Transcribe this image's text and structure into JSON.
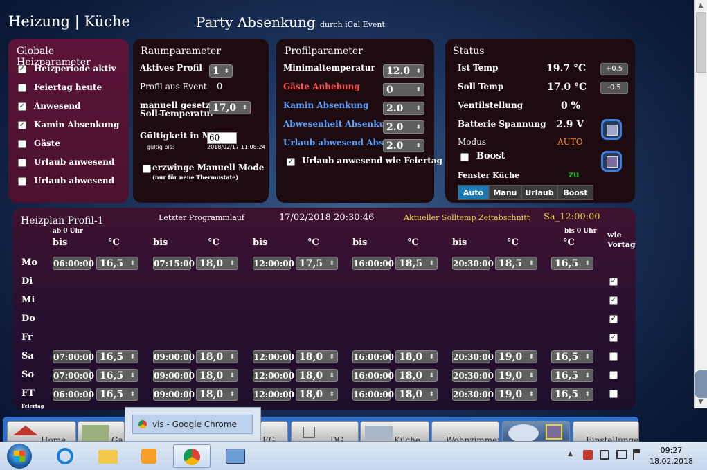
{
  "header": {
    "title": "Heizung | Küche",
    "party": "Party Absenkung",
    "party_sub": "durch iCal Event"
  },
  "global": {
    "title": "Globale Heizparameter",
    "items": [
      {
        "label": "Heizperiode aktiv",
        "checked": "✓"
      },
      {
        "label": "Feiertag heute",
        "checked": ""
      },
      {
        "label": "Anwesend",
        "checked": "✓"
      },
      {
        "label": "Kamin Absenkung",
        "checked": "✓"
      },
      {
        "label": "Gäste",
        "checked": ""
      },
      {
        "label": "Urlaub anwesend",
        "checked": ""
      },
      {
        "label": "Urlaub abwesend",
        "checked": ""
      }
    ]
  },
  "room": {
    "title": "Raumparameter",
    "active_profile_label": "Aktives Profil",
    "active_profile_value": "1",
    "profile_event_label": "Profil aus Event",
    "profile_event_value": "0",
    "manual_label_1": "manuell gesetzte",
    "manual_label_2": "Soll-Temperatur",
    "manual_value": "17,0",
    "valid_label": "Gültigkeit in Min",
    "valid_value": "60",
    "valid_until_label": "gültig bis:",
    "valid_until_value": "2018/02/17 11:08:24",
    "force_label": "erzwinge Manuell Mode",
    "force_sub": "(nur für neue Thermostate)"
  },
  "profile": {
    "title": "Profilparameter",
    "rows": [
      {
        "label": "Minimaltemperatur",
        "value": "12.0"
      },
      {
        "label": "Gäste Anhebung",
        "value": "0"
      },
      {
        "label": "Kamin Absenkung",
        "value": "2.0"
      },
      {
        "label": "Abwesenheit Absenkung",
        "value": "2.0"
      },
      {
        "label": "Urlaub abwesend Abs.",
        "value": "2.0"
      }
    ],
    "holiday_label": "Urlaub anwesend wie Feiertag",
    "holiday_checked": "✓"
  },
  "status": {
    "title": "Status",
    "ist_label": "Ist Temp",
    "ist_value": "19.7 °C",
    "ist_btn": "+0.5",
    "soll_label": "Soll Temp",
    "soll_value": "17.0 °C",
    "soll_btn": "-0.5",
    "valve_label": "Ventilstellung",
    "valve_value": "0 %",
    "battery_label": "Batterie Spannung",
    "battery_value": "2.9 V",
    "mode_label": "Modus",
    "mode_value": "AUTO",
    "boost_label": "Boost",
    "window_label": "Fenster Küche",
    "window_value": "zu",
    "modes": [
      "Auto",
      "Manu",
      "Urlaub",
      "Boost"
    ]
  },
  "plan": {
    "title": "Heizplan Profil-1",
    "last_run_label": "Letzter Programmlauf",
    "last_run_value": "17/02/2018 20:30:46",
    "current_label": "Aktueller Solltemp Zeitabschnitt",
    "current_value": "Sa_12:00:00",
    "from_label": "ab 0 Uhr",
    "to_label": "bis 0 Uhr",
    "bis": "bis",
    "deg": "°C",
    "wie_vortag_1": "wie",
    "wie_vortag_2": "Vortag",
    "ft_sub": "Feiertag",
    "days": [
      {
        "name": "Mo",
        "times": [
          "06:00:00",
          "07:15:00",
          "12:00:00",
          "16:00:00",
          "20:30:00"
        ],
        "temps": [
          "16,5",
          "18,0",
          "17,5",
          "18,5",
          "18,5",
          "16,5"
        ],
        "same": ""
      },
      {
        "name": "Di",
        "times": [],
        "temps": [],
        "same": "✓"
      },
      {
        "name": "Mi",
        "times": [],
        "temps": [],
        "same": "✓"
      },
      {
        "name": "Do",
        "times": [],
        "temps": [],
        "same": "✓"
      },
      {
        "name": "Fr",
        "times": [],
        "temps": [],
        "same": "✓"
      },
      {
        "name": "Sa",
        "times": [
          "07:00:00",
          "09:00:00",
          "12:00:00",
          "16:00:00",
          "20:30:00"
        ],
        "temps": [
          "16,5",
          "18,0",
          "18,0",
          "18,0",
          "19,0",
          "16,5"
        ],
        "same": ""
      },
      {
        "name": "So",
        "times": [
          "07:00:00",
          "09:00:00",
          "12:00:00",
          "16:00:00",
          "20:30:00"
        ],
        "temps": [
          "16,5",
          "18,0",
          "18,0",
          "18,0",
          "19,0",
          "16,5"
        ],
        "same": ""
      },
      {
        "name": "FT",
        "times": [
          "06:00:00",
          "09:00:00",
          "12:00:00",
          "16:00:00",
          "20:30:00"
        ],
        "temps": [
          "16,5",
          "18,0",
          "18,0",
          "18,0",
          "19,0",
          "16,5"
        ],
        "same": ""
      }
    ]
  },
  "nav_tabs": [
    "Home",
    "Ga",
    "EG",
    "DG",
    "Küche",
    "Wohnzimmer",
    "",
    "Einstellungen"
  ],
  "chrome_popup": "vis - Google Chrome",
  "taskbar": {
    "time": "09:27",
    "date": "18.02.2018"
  },
  "colors": {
    "accent": "#1c7ab5",
    "mode_value": "#ff8c1a",
    "window_ok": "#22c02a",
    "current_section": "#e8d23a"
  }
}
